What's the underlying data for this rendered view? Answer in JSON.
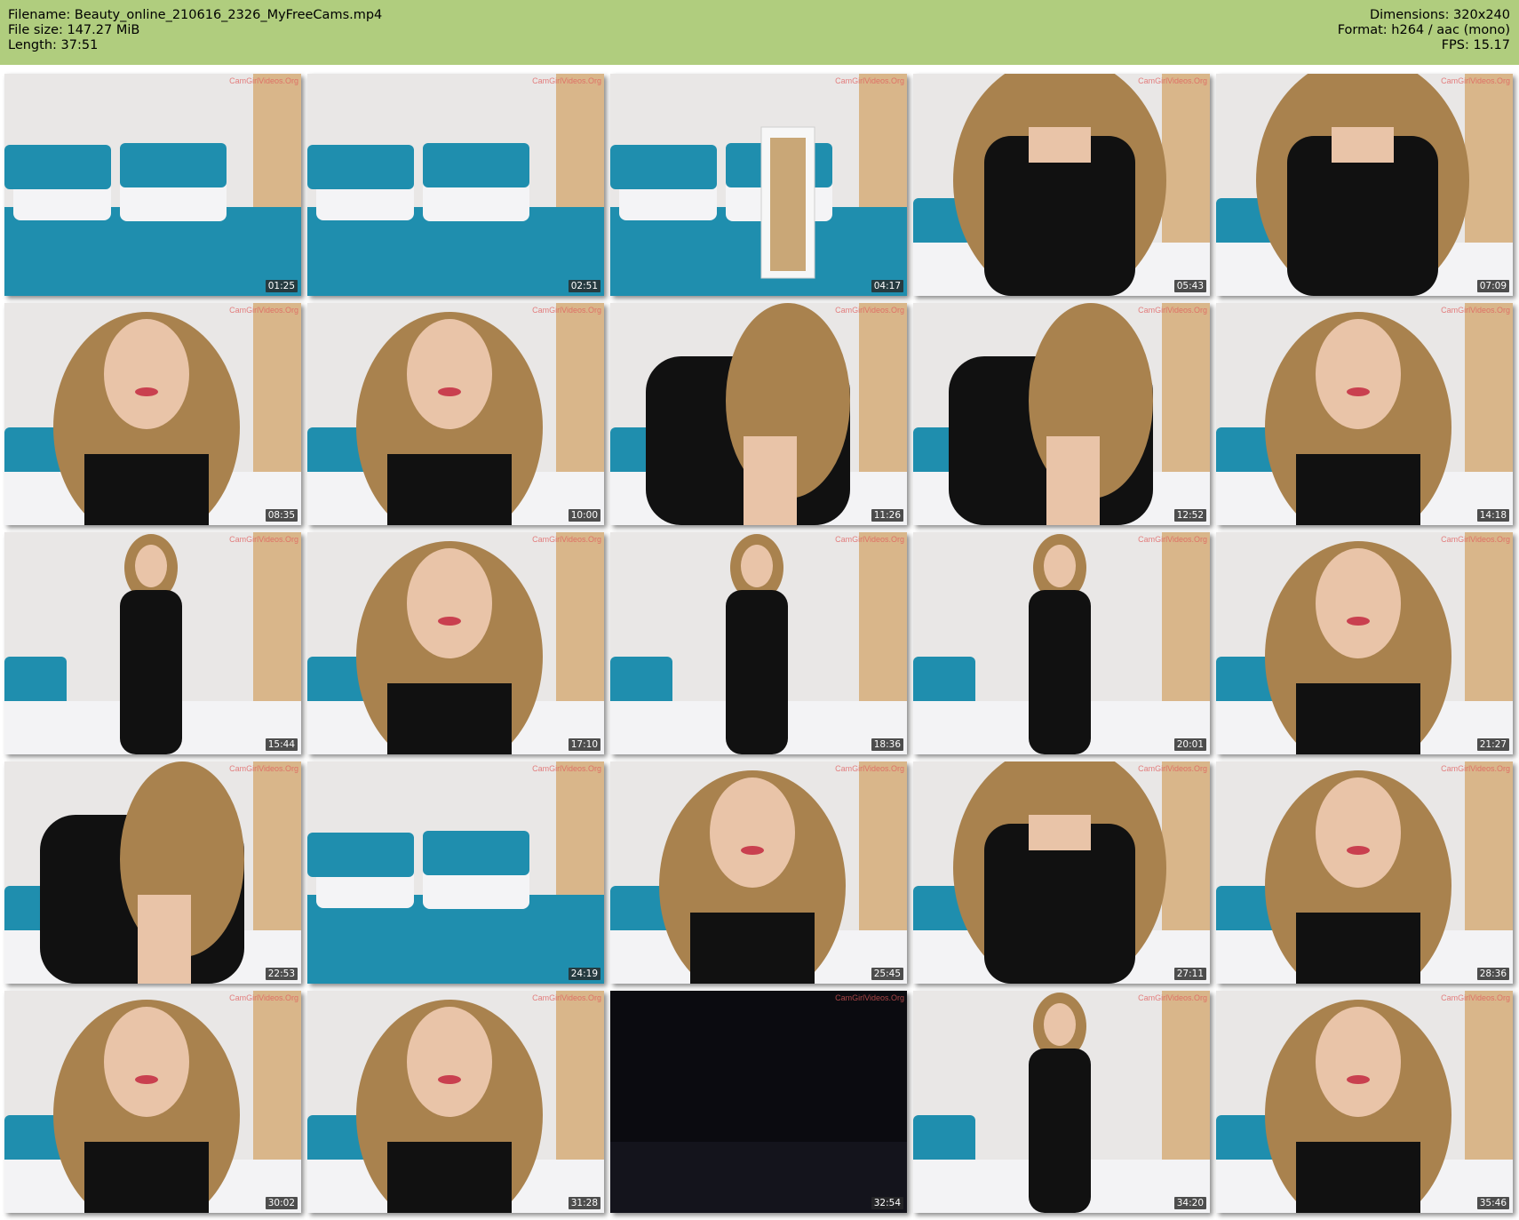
{
  "header": {
    "filename_line": "Filename: Beauty_online_210616_2326_MyFreeCams.mp4",
    "filesize_line": "File size: 147.27 MiB",
    "length_line": "Length: 37:51",
    "dimensions_line": "Dimensions: 320x240",
    "format_line": "Format: h264 / aac (mono)",
    "fps_line": "FPS: 15.17"
  },
  "watermark": "CamGirlVideos.Org",
  "colors": {
    "header_bg": "#b0cd7e",
    "wall": "#e9e7e6",
    "teal": "#1f8eae",
    "hair": "#a9824e",
    "top": "#111111",
    "skin": "#e9c4a8"
  },
  "thumbnails": [
    {
      "time": "01:25",
      "scene": "room"
    },
    {
      "time": "02:51",
      "scene": "bed"
    },
    {
      "time": "04:17",
      "scene": "room-mirror"
    },
    {
      "time": "05:43",
      "scene": "closeup"
    },
    {
      "time": "07:09",
      "scene": "closeup"
    },
    {
      "time": "08:35",
      "scene": "face"
    },
    {
      "time": "10:00",
      "scene": "face"
    },
    {
      "time": "11:26",
      "scene": "lean"
    },
    {
      "time": "12:52",
      "scene": "lean"
    },
    {
      "time": "14:18",
      "scene": "face"
    },
    {
      "time": "15:44",
      "scene": "standing"
    },
    {
      "time": "17:10",
      "scene": "face"
    },
    {
      "time": "18:36",
      "scene": "standing"
    },
    {
      "time": "20:01",
      "scene": "standing"
    },
    {
      "time": "21:27",
      "scene": "face"
    },
    {
      "time": "22:53",
      "scene": "lean"
    },
    {
      "time": "24:19",
      "scene": "bed"
    },
    {
      "time": "25:45",
      "scene": "face"
    },
    {
      "time": "27:11",
      "scene": "closeup"
    },
    {
      "time": "28:36",
      "scene": "face"
    },
    {
      "time": "30:02",
      "scene": "face"
    },
    {
      "time": "31:28",
      "scene": "face"
    },
    {
      "time": "32:54",
      "scene": "dark"
    },
    {
      "time": "34:20",
      "scene": "standing"
    },
    {
      "time": "35:46",
      "scene": "face"
    }
  ]
}
